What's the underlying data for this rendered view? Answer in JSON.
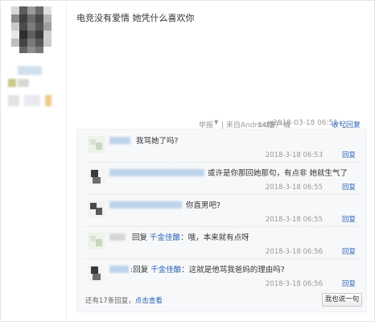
{
  "post": {
    "text": "电竞没有爱情 她凭什么喜欢你",
    "meta": {
      "report": "举报",
      "dropdown_glyph": "▼",
      "source": "| 来自Android客户端",
      "floor": "14楼",
      "timestamp": "2018-03-18 06:51",
      "collapse_reply": "收起回复"
    }
  },
  "replies": [
    {
      "text_prefix": "",
      "text_link": "",
      "text": "我骂她了吗?",
      "time": "2018-3-18 06:53",
      "reply_label": "回复"
    },
    {
      "text_prefix": "",
      "text_link": "",
      "text": "或许是你那回她那句，有点非 她就生气了",
      "time": "2018-3-18 06:55",
      "reply_label": "回复"
    },
    {
      "text_prefix": "",
      "text_link": "",
      "text": "你直男吧?",
      "time": "2018-3-18 06:55",
      "reply_label": "回复"
    },
    {
      "text_prefix": "回复",
      "text_link": "千金佳酿",
      "text": "：哦，本来就有点呀",
      "time": "2018-3-18 06:56",
      "reply_label": "回复"
    },
    {
      "text_prefix": ":回复",
      "text_link": "千金佳酿",
      "text": "：这就是他骂我爸妈的理由吗?",
      "time": "2018-3-18 06:56",
      "reply_label": "回复"
    }
  ],
  "footer": {
    "more_prefix": "还有17条回复，",
    "more_link": "点击查看",
    "say_button": "我也说一句"
  },
  "colors": {
    "link": "#2d64b3",
    "panel_bg": "#f7f8fa",
    "meta": "#999999"
  }
}
